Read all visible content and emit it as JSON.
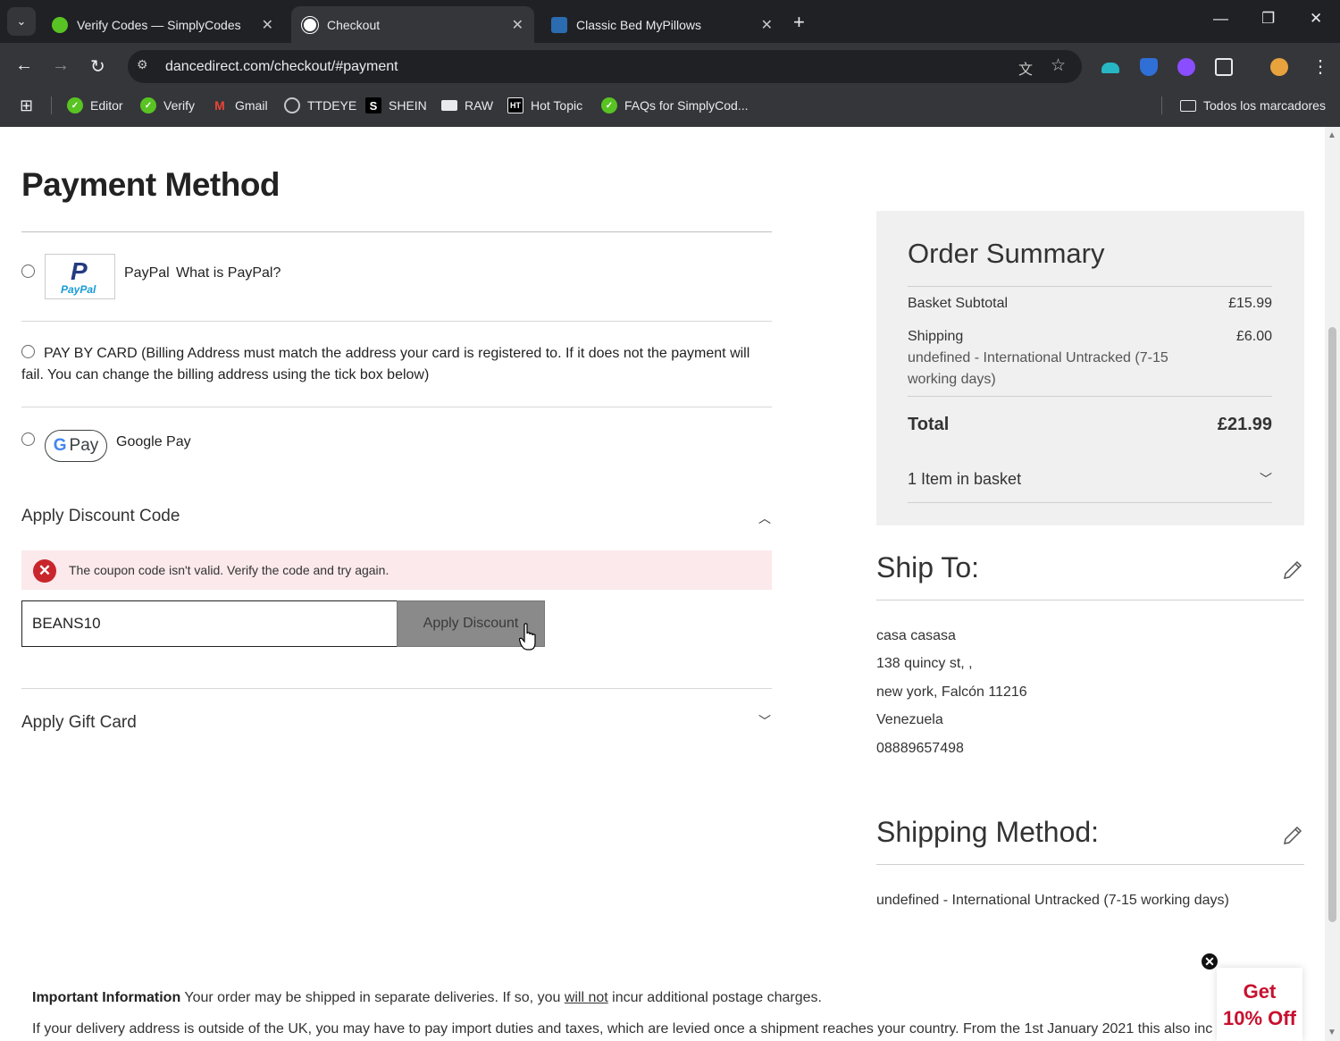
{
  "browser": {
    "tabs": [
      {
        "title": "Verify Codes — SimplyCodes",
        "icon": "simplycodes-icon",
        "color": "#58c322"
      },
      {
        "title": "Checkout",
        "icon": "dancedirect-icon",
        "color": "#ffffff"
      },
      {
        "title": "Classic Bed MyPillows",
        "icon": "mypillow-icon",
        "color": "#2b6cb0"
      }
    ],
    "url": "dancedirect.com/checkout/#payment",
    "bookmarks": [
      {
        "label": "Editor",
        "icon": "simplycodes-icon"
      },
      {
        "label": "Verify",
        "icon": "simplycodes-icon"
      },
      {
        "label": "Gmail",
        "icon": "gmail-icon"
      },
      {
        "label": "TTDEYE",
        "icon": "globe-icon"
      },
      {
        "label": "SHEIN",
        "icon": "shein-icon"
      },
      {
        "label": "RAW",
        "icon": "raw-icon"
      },
      {
        "label": "Hot Topic",
        "icon": "hottopic-icon"
      },
      {
        "label": "FAQs for SimplyCod...",
        "icon": "simplycodes-icon"
      }
    ],
    "all_bookmarks": "Todos los marcadores"
  },
  "payment": {
    "title": "Payment Method",
    "paypal_label": "PayPal",
    "paypal_link": "What is PayPal?",
    "paypal_logo_letter": "P",
    "paypal_logo_text": "PayPal",
    "card_line1": "PAY BY CARD (Billing Address must match the address your card is registered to. If it does not the payment will",
    "card_line2": "fail. You can change the billing address using the tick box below)",
    "gpay_g": "G",
    "gpay_pay": "Pay",
    "gpay_label": "Google Pay"
  },
  "discount": {
    "heading": "Apply Discount Code",
    "error": "The coupon code isn't valid. Verify the code and try again.",
    "code_value": "BEANS10",
    "button": "Apply Discount"
  },
  "gift": {
    "heading": "Apply Gift Card"
  },
  "order_summary": {
    "title": "Order Summary",
    "subtotal_label": "Basket Subtotal",
    "subtotal_value": "£15.99",
    "shipping_label": "Shipping",
    "shipping_value": "£6.00",
    "shipping_desc_1": "undefined - International Untracked (7-15",
    "shipping_desc_2": "working days)",
    "total_label": "Total",
    "total_value": "£21.99",
    "items": "1 Item in basket"
  },
  "ship_to": {
    "title": "Ship To:",
    "lines": [
      "casa casasa",
      "138 quincy st, ,",
      "new york, Falcón 11216",
      "Venezuela",
      "08889657498"
    ]
  },
  "shipping_method": {
    "title": "Shipping Method:",
    "value": "undefined - International Untracked (7-15 working days)"
  },
  "info": {
    "bold": "Important Information",
    "line1a": " Your order may be shipped in separate deliveries. If so, you ",
    "line1u": "will not",
    "line1b": " incur additional postage charges.",
    "line2": "If your delivery address is outside of the UK, you may have to pay import duties and taxes, which are levied once a shipment reaches your country. From the 1st January 2021 this also inc"
  },
  "popup": {
    "line1": "Get",
    "line2": "10% Off"
  }
}
